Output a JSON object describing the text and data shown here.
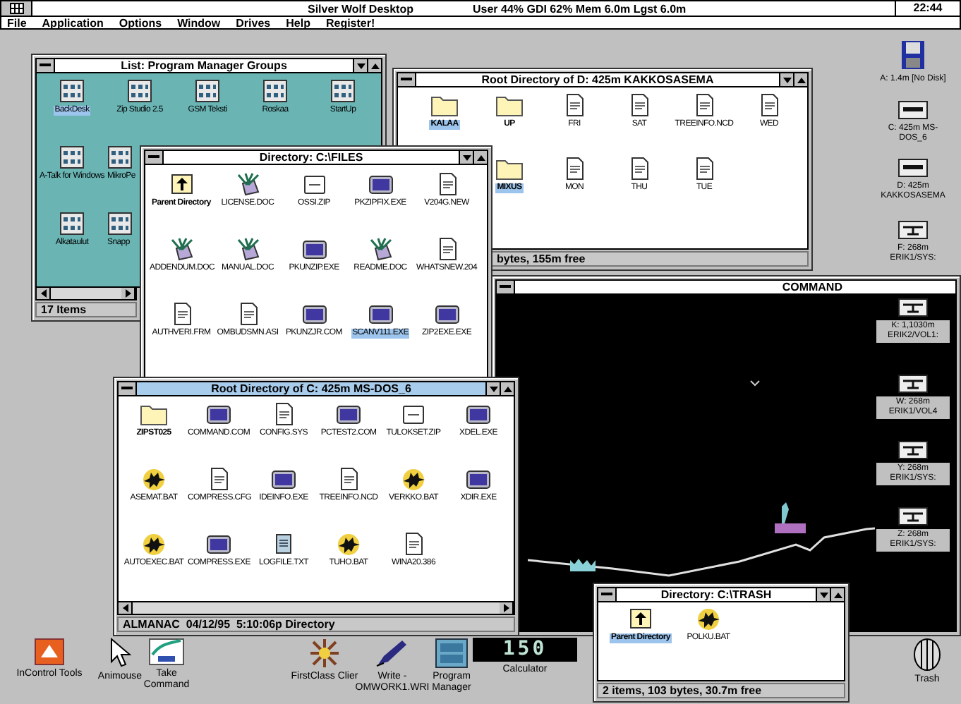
{
  "top_bar": {
    "title": "Silver Wolf Desktop",
    "resources": "User 44% GDI 62% Mem 6.0m Lgst 6.0m",
    "clock": "22:44"
  },
  "menu": [
    "File",
    "Application",
    "Options",
    "Window",
    "Drives",
    "Help",
    "Register!"
  ],
  "windows": [
    {
      "kind": "groups",
      "title": "List: Program Manager Groups",
      "active": false,
      "status": "17 Items",
      "rows": [
        [
          {
            "label": "BackDesk",
            "kind": "group",
            "selected": true,
            "clipped": false
          },
          {
            "label": "Zip Studio 2.5",
            "kind": "group",
            "selected": false,
            "clipped": false
          },
          {
            "label": "GSM Teksti",
            "kind": "group",
            "selected": false,
            "clipped": false
          },
          {
            "label": "Roskaa",
            "kind": "group",
            "selected": false,
            "clipped": false
          },
          {
            "label": "StartUp",
            "kind": "group",
            "selected": false,
            "clipped": false
          }
        ],
        [
          {
            "label": "A-Talk for Windows",
            "kind": "group",
            "selected": false,
            "clipped": false
          },
          {
            "label": "MikroPe",
            "kind": "group",
            "selected": false,
            "clipped": true
          }
        ],
        [
          {
            "label": "Alkataulut",
            "kind": "group",
            "selected": false,
            "clipped": false
          },
          {
            "label": "Snapp",
            "kind": "group",
            "selected": false,
            "clipped": true
          }
        ]
      ]
    },
    {
      "kind": "directory",
      "title": "Root Directory of D: 425m KAKKOSASEMA",
      "active": false,
      "status": "bytes, 155m free",
      "rows": [
        [
          {
            "label": "KALAA",
            "kind": "folder",
            "selected": true
          },
          {
            "label": "UP",
            "kind": "folder",
            "selected": false
          },
          {
            "label": "FRI",
            "kind": "document",
            "selected": false
          },
          {
            "label": "SAT",
            "kind": "document",
            "selected": false
          },
          {
            "label": "TREEINFO.NCD",
            "kind": "document",
            "selected": false
          },
          {
            "label": "WED",
            "kind": "document",
            "selected": false
          }
        ],
        [
          "",
          {
            "label": "MIXUS",
            "kind": "folder",
            "selected": true
          },
          {
            "label": "MON",
            "kind": "document",
            "selected": false
          },
          {
            "label": "THU",
            "kind": "document",
            "selected": false
          },
          {
            "label": "TUE",
            "kind": "document",
            "selected": false
          }
        ]
      ]
    },
    {
      "kind": "directory",
      "title": "Directory: C:\\FILES",
      "active": false,
      "rows": [
        [
          {
            "label": "Parent Directory",
            "kind": "parent",
            "selected": false
          },
          {
            "label": "LICENSE.DOC",
            "kind": "write",
            "selected": false
          },
          {
            "label": "OSSI.ZIP",
            "kind": "zip",
            "selected": false
          },
          {
            "label": "PKZIPFIX.EXE",
            "kind": "exe",
            "selected": false
          },
          {
            "label": "V204G.NEW",
            "kind": "document",
            "selected": false
          }
        ],
        [
          {
            "label": "ADDENDUM.DOC",
            "kind": "write",
            "selected": false
          },
          {
            "label": "MANUAL.DOC",
            "kind": "write",
            "selected": false
          },
          {
            "label": "PKUNZIP.EXE",
            "kind": "exe",
            "selected": false
          },
          {
            "label": "README.DOC",
            "kind": "write",
            "selected": false
          },
          {
            "label": "WHATSNEW.204",
            "kind": "document",
            "selected": false
          }
        ],
        [
          {
            "label": "AUTHVERI.FRM",
            "kind": "document",
            "selected": false
          },
          {
            "label": "OMBUDSMN.ASI",
            "kind": "document",
            "selected": false
          },
          {
            "label": "PKUNZJR.COM",
            "kind": "exe",
            "selected": false
          },
          {
            "label": "SCANV111.EXE",
            "kind": "exe",
            "selected": true
          },
          {
            "label": "ZIP2EXE.EXE",
            "kind": "exe",
            "selected": false
          }
        ]
      ]
    },
    {
      "kind": "console",
      "title": "COMMAND",
      "active": false
    },
    {
      "kind": "directory",
      "title": "Root Directory of C: 425m MS-DOS_6",
      "active": true,
      "status": "ALMANAC  04/12/95  5:10:06p Directory",
      "rows": [
        [
          {
            "label": "ZIPST025",
            "kind": "folder",
            "selected": false
          },
          {
            "label": "COMMAND.COM",
            "kind": "exe",
            "selected": false
          },
          {
            "label": "CONFIG.SYS",
            "kind": "document",
            "selected": false
          },
          {
            "label": "PCTEST2.COM",
            "kind": "exe",
            "selected": false
          },
          {
            "label": "TULOKSET.ZIP",
            "kind": "zip",
            "selected": false
          },
          {
            "label": "XDEL.EXE",
            "kind": "exe",
            "selected": false
          }
        ],
        [
          {
            "label": "ASEMAT.BAT",
            "kind": "bat",
            "selected": false
          },
          {
            "label": "COMPRESS.CFG",
            "kind": "document",
            "selected": false
          },
          {
            "label": "IDEINFO.EXE",
            "kind": "exe",
            "selected": false
          },
          {
            "label": "TREEINFO.NCD",
            "kind": "document",
            "selected": false
          },
          {
            "label": "VERKKO.BAT",
            "kind": "bat",
            "selected": false
          },
          {
            "label": "XDIR.EXE",
            "kind": "exe",
            "selected": false
          }
        ],
        [
          {
            "label": "AUTOEXEC.BAT",
            "kind": "bat",
            "selected": false
          },
          {
            "label": "COMPRESS.EXE",
            "kind": "exe",
            "selected": false
          },
          {
            "label": "LOGFILE.TXT",
            "kind": "notepad",
            "selected": false
          },
          {
            "label": "TUHO.BAT",
            "kind": "bat",
            "selected": false
          },
          {
            "label": "WINA20.386",
            "kind": "document",
            "selected": false
          }
        ]
      ]
    },
    {
      "kind": "directory",
      "title": "Directory: C:\\TRASH",
      "active": false,
      "status": "2 items, 103 bytes, 30.7m free",
      "rows": [
        [
          {
            "label": "Parent Directory",
            "kind": "parent",
            "selected": true
          },
          {
            "label": "POLKU.BAT",
            "kind": "bat",
            "selected": false
          }
        ]
      ]
    }
  ],
  "drives": [
    {
      "label": "A: 1.4m [No Disk]",
      "kind": "floppy"
    },
    {
      "label": "C: 425m MS-DOS_6",
      "kind": "hdd"
    },
    {
      "label": "D: 425m KAKKOSASEMA",
      "kind": "hdd"
    },
    {
      "label": "F: 268m ERIK1/SYS:",
      "kind": "network"
    },
    {
      "label": "K: 1,1030m ERIK2/VOL1:",
      "kind": "network"
    },
    {
      "label": "W: 268m ERIK1/VOL4",
      "kind": "network"
    },
    {
      "label": "Y: 268m ERIK1/SYS:",
      "kind": "network"
    },
    {
      "label": "Z: 268m ERIK1/SYS:",
      "kind": "network"
    }
  ],
  "desktop_icons": [
    {
      "label": "InControl Tools",
      "kind": "incontrol"
    },
    {
      "label": "Animouse",
      "kind": "mouse"
    },
    {
      "label": "Take Command",
      "kind": "command"
    },
    {
      "label": "FirstClass Clier",
      "kind": "firstclass"
    },
    {
      "label": "Write - OMWORK1.WRI",
      "kind": "write"
    },
    {
      "label": "Program Manager",
      "kind": "progman"
    },
    {
      "label": "Calculator",
      "kind": "calculator",
      "display": "150"
    },
    {
      "label": "Trash",
      "kind": "trash"
    }
  ]
}
